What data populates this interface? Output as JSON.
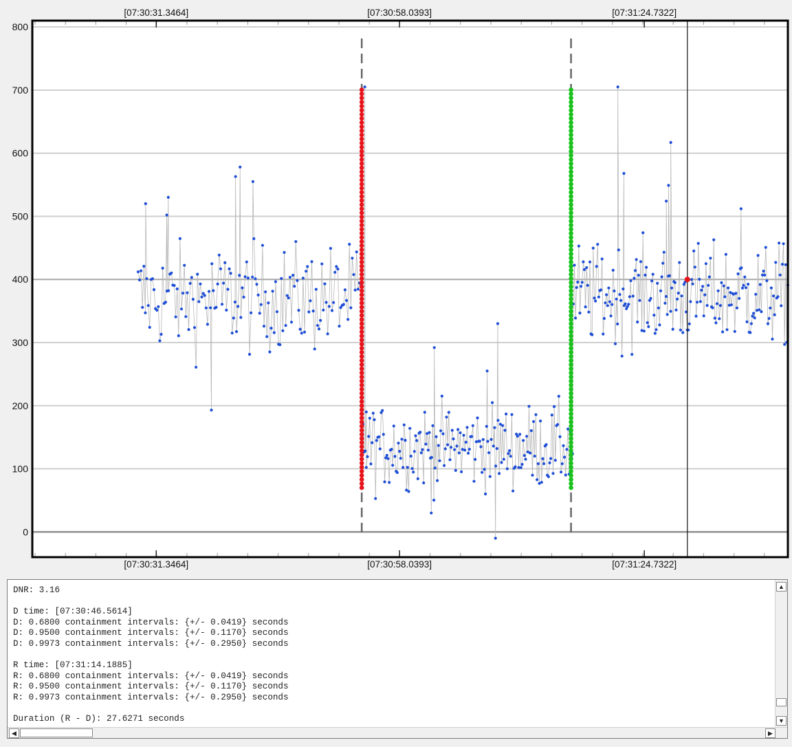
{
  "chart_data": {
    "type": "scatter",
    "title": "",
    "xlabel": "",
    "ylabel": "",
    "ylim": [
      -40,
      810
    ],
    "y_ticks": [
      0,
      100,
      200,
      300,
      400,
      500,
      600,
      700,
      800
    ],
    "grid": true,
    "x_time_labels": [
      "[07:30:31.3464]",
      "[07:30:58.0393]",
      "[07:31:24.7322]"
    ],
    "series": [
      {
        "color": "#1f4fd6",
        "marker": "dot",
        "connector_color": "#b8b8b8",
        "segments": [
          {
            "x_range_s": [
              14.0,
              43.5
            ],
            "baseline": 370,
            "spread": 70,
            "count": 155
          },
          {
            "x_range_s": [
              43.6,
              71.5
            ],
            "baseline": 135,
            "spread": 55,
            "count": 185
          },
          {
            "x_range_s": [
              71.6,
              100.0
            ],
            "baseline": 375,
            "spread": 65,
            "count": 195
          }
        ],
        "highlights": [
          {
            "x_s": 44.0,
            "y": 705
          },
          {
            "x_s": 44.2,
            "y": 190
          },
          {
            "x_s": 52.8,
            "y": 30
          },
          {
            "x_s": 61.6,
            "y": 330
          },
          {
            "x_s": 61.3,
            "y": -10
          },
          {
            "x_s": 77.5,
            "y": 705
          },
          {
            "x_s": 27.5,
            "y": 578
          },
          {
            "x_s": 26.9,
            "y": 563
          },
          {
            "x_s": 29.2,
            "y": 555
          },
          {
            "x_s": 23.7,
            "y": 193
          },
          {
            "x_s": 18.0,
            "y": 530
          },
          {
            "x_s": 17.8,
            "y": 502
          },
          {
            "x_s": 15.0,
            "y": 520
          },
          {
            "x_s": 78.3,
            "y": 568
          },
          {
            "x_s": 84.5,
            "y": 617
          },
          {
            "x_s": 84.2,
            "y": 549
          },
          {
            "x_s": 83.9,
            "y": 524
          },
          {
            "x_s": 93.8,
            "y": 512
          },
          {
            "x_s": 53.2,
            "y": 292
          },
          {
            "x_s": 60.2,
            "y": 255
          }
        ]
      }
    ],
    "d_marker": {
      "x_s": 43.6,
      "color": "#e8141b",
      "y_from": 70,
      "y_to": 705
    },
    "r_marker": {
      "x_s": 71.3,
      "color": "#19c21c",
      "y_from": 70,
      "y_to": 705
    },
    "cursor": {
      "x_s": 86.7,
      "point_y": 400,
      "point_color": "#e8141b"
    }
  },
  "report": {
    "lines": [
      "DNR: 3.16",
      "",
      "D time: [07:30:46.5614]",
      "D: 0.6800 containment intervals: {+/- 0.0419} seconds",
      "D: 0.9500 containment intervals: {+/- 0.1170} seconds",
      "D: 0.9973 containment intervals: {+/- 0.2950} seconds",
      "",
      "R time: [07:31:14.1885]",
      "R: 0.6800 containment intervals: {+/- 0.0419} seconds",
      "R: 0.9500 containment intervals: {+/- 0.1170} seconds",
      "R: 0.9973 containment intervals: {+/- 0.2950} seconds",
      "",
      "Duration (R - D): 27.6271 seconds"
    ]
  },
  "scrollbars": {
    "up_icon": "▲",
    "down_icon": "▼",
    "left_icon": "◀",
    "right_icon": "▶"
  }
}
